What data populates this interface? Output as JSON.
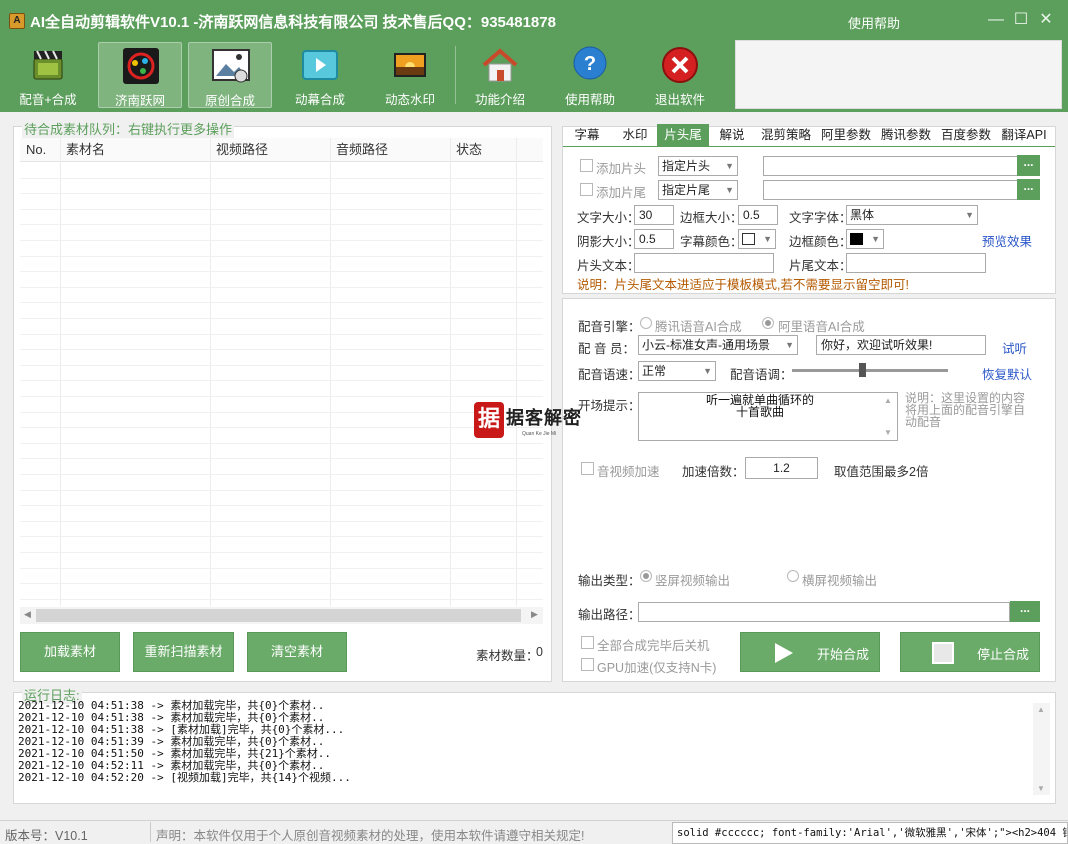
{
  "window": {
    "title": "AI全自动剪辑软件V10.1 -济南跃网信息科技有限公司 技术售后QQ：935481878",
    "help": "使用帮助",
    "controls": [
      "—",
      "☐",
      "✕"
    ]
  },
  "toolbar": {
    "buttons": [
      {
        "label": "配音+合成",
        "icon": "film-clapper-icon"
      },
      {
        "label": "济南跃网",
        "icon": "film-reel-icon"
      },
      {
        "label": "原创合成",
        "icon": "landscape-image-icon"
      },
      {
        "label": "动幕合成",
        "icon": "play-video-icon"
      },
      {
        "label": "动态水印",
        "icon": "sunset-picture-icon"
      },
      {
        "label": "功能介绍",
        "icon": "home-icon"
      },
      {
        "label": "使用帮助",
        "icon": "help-question-icon"
      },
      {
        "label": "退出软件",
        "icon": "exit-close-icon"
      }
    ]
  },
  "queue": {
    "legend": "待合成素材队列：右键执行更多操作",
    "columns": [
      "No.",
      "素材名",
      "视频路径",
      "音频路径",
      "状态"
    ],
    "buttons": {
      "load": "加载素材",
      "rescan": "重新扫描素材",
      "clear": "清空素材"
    },
    "count_label": "素材数量：",
    "count": "0"
  },
  "tabs": [
    "字幕",
    "水印",
    "片头尾",
    "解说",
    "混剪策略",
    "阿里参数",
    "腾讯参数",
    "百度参数",
    "翻译API"
  ],
  "selected_tab": "片头尾",
  "intro_outro": {
    "add_head": "添加片头",
    "add_tail": "添加片尾",
    "head_select": "指定片头",
    "tail_select": "指定片尾",
    "browse": "...",
    "font_size_label": "文字大小：",
    "font_size": "30",
    "border_size_label": "边框大小：",
    "border_size": "0.5",
    "font_label": "文字字体：",
    "font": "黑体",
    "shadow_label": "阴影大小：",
    "shadow": "0.5",
    "sub_color_label": "字幕颜色：",
    "border_color_label": "边框颜色：",
    "preview": "预览效果",
    "head_text_label": "片头文本：",
    "tail_text_label": "片尾文本：",
    "note": "说明：片头尾文本进适应于模板模式,若不需要显示留空即可!"
  },
  "dubbing": {
    "engine_label": "配音引擎：",
    "engine_tencent": "腾讯语音AI合成",
    "engine_ali": "阿里语音AI合成",
    "voice_label": "配 音 员：",
    "voice": "小云-标准女声-通用场景",
    "test_text": "你好，欢迎试听效果!",
    "listen": "试听",
    "speed_label": "配音语速：",
    "speed": "正常",
    "pitch_label": "配音语调：",
    "pitch_value": 0.45,
    "reset": "恢复默认",
    "opening_label": "开场提示：",
    "opening_text": "听一遍就单曲循环的\n十首歌曲",
    "opening_note": "说明：这里设置的内容将用上面的配音引擎自动配音",
    "accel_label": "音视频加速",
    "accel_rate_label": "加速倍数：",
    "accel_rate": "1.2",
    "accel_hint": "取值范围最多2倍",
    "output_type_label": "输出类型：",
    "output_vertical": "竖屏视频输出",
    "output_horizontal": "横屏视频输出",
    "output_path_label": "输出路径：",
    "shutdown": "全部合成完毕后关机",
    "gpu": "GPU加速(仅支持N卡)",
    "start": "开始合成",
    "stop": "停止合成"
  },
  "watermark": {
    "main": "据客解密",
    "sub": "Quan Ke Jie Mi"
  },
  "log": {
    "legend": "运行日志:",
    "lines": [
      "2021-12-10 04:51:38 -> 素材加载完毕，共{0}个素材..",
      "2021-12-10 04:51:38 -> 素材加载完毕，共{0}个素材..",
      "2021-12-10 04:51:38 -> [素材加载]完毕，共{0}个素材...",
      "2021-12-10 04:51:39 -> 素材加载完毕，共{0}个素材..",
      "2021-12-10 04:51:50 -> 素材加载完毕，共{21}个素材..",
      "2021-12-10 04:52:11 -> 素材加载完毕，共{0}个素材..",
      "2021-12-10 04:52:20 -> [视频加载]完毕，共{14}个视频..."
    ]
  },
  "status": {
    "version": "版本号：V10.1",
    "disclaimer": "声明：本软件仅用于个人原创音视频素材的处理，使用本软件请遵守相关规定!",
    "marquee": "solid #cccccc; font-family:'Arial','微软雅黑','宋体';\"><h2>404 错"
  },
  "colors": {
    "accent": "#5c9f5c",
    "link": "#2a56c8",
    "note": "#b45a00"
  }
}
